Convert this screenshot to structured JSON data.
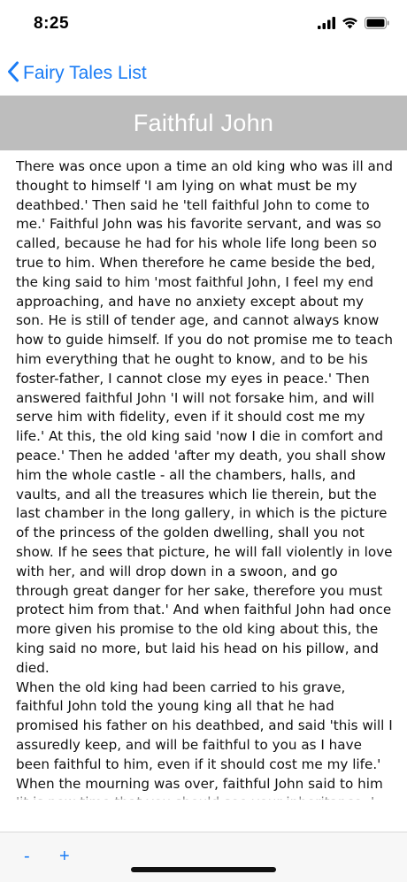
{
  "status_bar": {
    "time": "8:25",
    "icons": [
      "signal-icon",
      "wifi-icon",
      "battery-icon"
    ]
  },
  "nav": {
    "back_label": "Fairy Tales List",
    "back_icon": "chevron-left-icon"
  },
  "story": {
    "title": "Faithful John",
    "text": "There was once upon a time an old king who was ill and thought to himself 'I am lying on what must be my deathbed.' Then said he 'tell faithful John to come to me.' Faithful John was his favorite servant, and was so called, because he had for his whole life long been so true to him. When therefore he came beside the bed, the king said to him 'most faithful John, I feel my end approaching, and have no anxiety except about my son. He is still of tender age, and cannot always know how to guide himself. If you do not promise me to teach him everything that he ought to know, and to be his foster-father, I cannot close my eyes in peace.' Then answered faithful John 'I will not forsake him, and will serve him with fidelity, even if it should cost me my life.' At this, the old king said 'now I die in comfort and peace.' Then he added 'after my death, you shall show him the whole castle - all the chambers, halls, and vaults, and all the treasures which lie therein, but the last chamber in the long gallery, in which is the picture of the princess of the golden dwelling, shall you not show. If he sees that picture, he will fall violently in love with her, and will drop down in a swoon, and go through great danger for her sake, therefore you must protect him from that.' And when faithful John had once more given his promise to the old king about this, the king said no more, but laid his head on his pillow, and died.\nWhen the old king had been carried to his grave, faithful John told the young king all that he had promised his father on his deathbed, and said 'this will I assuredly keep, and will be faithful to you as I have been faithful to him, even if it should cost me my life.' When the mourning was over, faithful John said to him 'it is now time that you should see your inheritance. I will show you your father's palace.' Then"
  },
  "toolbar": {
    "decrease_label": "-",
    "increase_label": "+"
  },
  "colors": {
    "accent": "#1a7cf5",
    "title_bar": "#bdbdbd",
    "title_text": "#ffffff"
  }
}
